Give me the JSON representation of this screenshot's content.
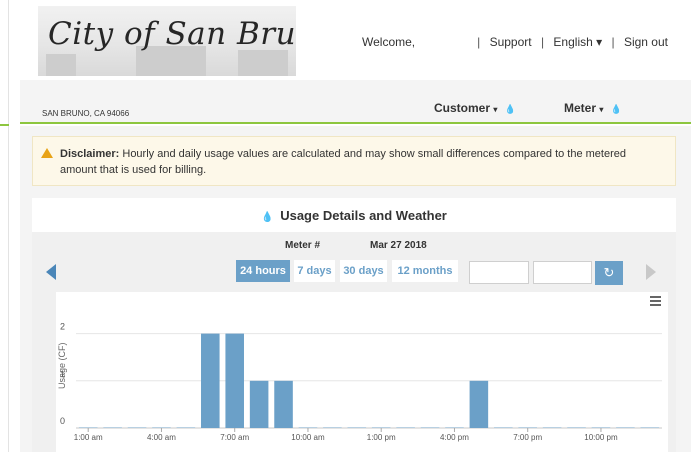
{
  "header": {
    "logo_text": "City of San Bruno",
    "welcome": "Welcome,",
    "links": [
      "Support",
      "English ▾",
      "Sign out"
    ]
  },
  "subbar": {
    "address": "SAN BRUNO, CA 94066",
    "customer_label": "Customer",
    "meter_label": "Meter",
    "caret": "▾",
    "drop_icon": "💧"
  },
  "disclaimer": {
    "label": "Disclaimer:",
    "text": "Hourly and daily usage values are calculated and may show small differences compared to the metered amount that is used for billing."
  },
  "panel": {
    "title": "Usage Details and Weather",
    "meter_label": "Meter #",
    "date_label": "Mar 27 2018",
    "ranges": [
      "24 hours",
      "7 days",
      "30 days",
      "12 months"
    ],
    "active_range": "24 hours",
    "start_date_value": "",
    "end_date_value": "",
    "refresh_icon": "refresh-icon"
  },
  "colors": {
    "accent": "#6ba0c8",
    "bar": "#6ba0c8",
    "green_rule": "#8dc63f",
    "warning": "#e8a317"
  },
  "chart_data": {
    "type": "bar",
    "ylabel": "Usage (CF)",
    "yticks": [
      0,
      1,
      2
    ],
    "ylim": [
      0,
      2.5
    ],
    "xtick_labels": [
      "1:00 am",
      "4:00 am",
      "7:00 am",
      "10:00 am",
      "1:00 pm",
      "4:00 pm",
      "7:00 pm",
      "10:00 pm"
    ],
    "categories": [
      "1:00 am",
      "2:00 am",
      "3:00 am",
      "4:00 am",
      "5:00 am",
      "6:00 am",
      "7:00 am",
      "8:00 am",
      "9:00 am",
      "10:00 am",
      "11:00 am",
      "12:00 pm",
      "1:00 pm",
      "2:00 pm",
      "3:00 pm",
      "4:00 pm",
      "5:00 pm",
      "6:00 pm",
      "7:00 pm",
      "8:00 pm",
      "9:00 pm",
      "10:00 pm",
      "11:00 pm",
      "12:00 am"
    ],
    "values": [
      0,
      0,
      0,
      0,
      0,
      2,
      2,
      1,
      1,
      0,
      0,
      0,
      0,
      0,
      0,
      0,
      1,
      0,
      0,
      0,
      0,
      0,
      0,
      0
    ],
    "grid": true
  }
}
